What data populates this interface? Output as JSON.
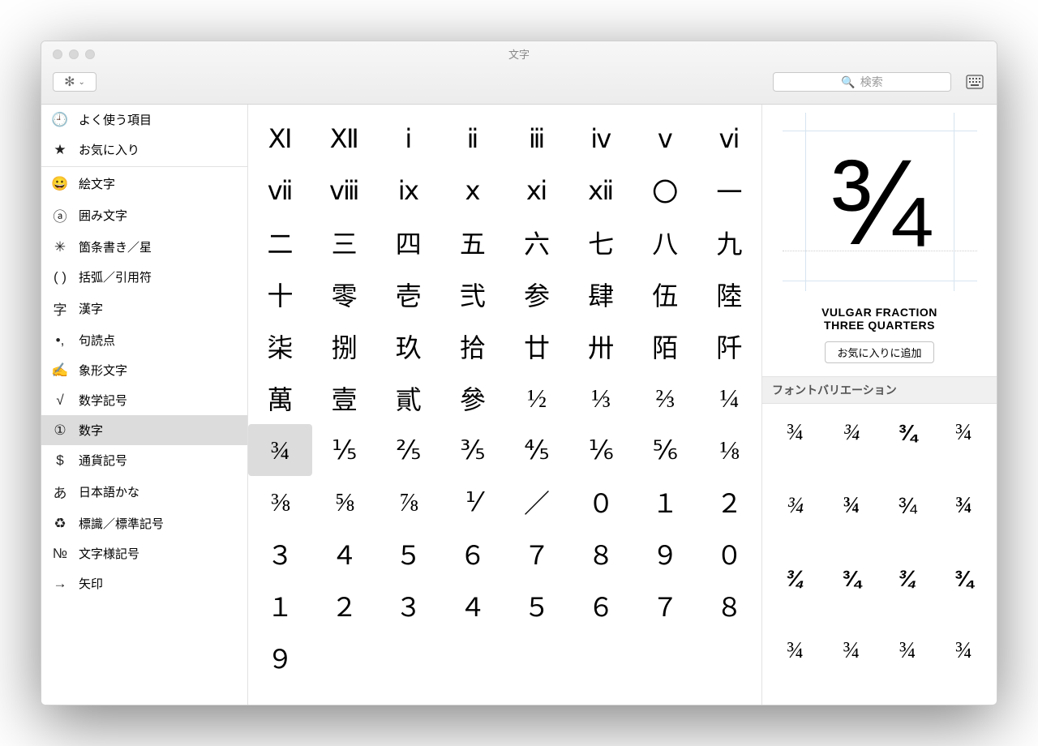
{
  "window": {
    "title": "文字"
  },
  "toolbar": {
    "search_placeholder": "検索"
  },
  "sidebar": {
    "frequent_label": "よく使う項目",
    "favorites_label": "お気に入り",
    "categories": [
      {
        "icon": "😀",
        "label": "絵文字"
      },
      {
        "icon": "ⓐ",
        "label": "囲み文字"
      },
      {
        "icon": "✳",
        "label": "箇条書き／星"
      },
      {
        "icon": "( )",
        "label": "括弧／引用符"
      },
      {
        "icon": "字",
        "label": "漢字"
      },
      {
        "icon": "•,",
        "label": "句読点"
      },
      {
        "icon": "✍",
        "label": "象形文字"
      },
      {
        "icon": "√",
        "label": "数学記号"
      },
      {
        "icon": "①",
        "label": "数字"
      },
      {
        "icon": "$",
        "label": "通貨記号"
      },
      {
        "icon": "あ",
        "label": "日本語かな"
      },
      {
        "icon": "♻",
        "label": "標識／標準記号"
      },
      {
        "icon": "№",
        "label": "文字様記号"
      },
      {
        "icon": "→",
        "label": "矢印"
      }
    ],
    "selected_index": 8
  },
  "grid": {
    "chars": [
      "Ⅺ",
      "Ⅻ",
      "ⅰ",
      "ⅱ",
      "ⅲ",
      "ⅳ",
      "ⅴ",
      "ⅵ",
      "ⅶ",
      "ⅷ",
      "ⅸ",
      "ⅹ",
      "ⅺ",
      "ⅻ",
      "〇",
      "一",
      "二",
      "三",
      "四",
      "五",
      "六",
      "七",
      "八",
      "九",
      "十",
      "零",
      "壱",
      "弐",
      "参",
      "肆",
      "伍",
      "陸",
      "柒",
      "捌",
      "玖",
      "拾",
      "廿",
      "卅",
      "陌",
      "阡",
      "萬",
      "壹",
      "貳",
      "參",
      "½",
      "⅓",
      "⅔",
      "¼",
      "¾",
      "⅕",
      "⅖",
      "⅗",
      "⅘",
      "⅙",
      "⅚",
      "⅛",
      "⅜",
      "⅝",
      "⅞",
      "⅟",
      "／",
      "０",
      "１",
      "２",
      "３",
      "４",
      "５",
      "６",
      "７",
      "８",
      "９",
      "０",
      "１",
      "２",
      "３",
      "４",
      "５",
      "６",
      "７",
      "８",
      "９"
    ],
    "selected_index": 48
  },
  "detail": {
    "glyph": "¾",
    "name": "VULGAR FRACTION\nTHREE QUARTERS",
    "add_favorite_label": "お気に入りに追加",
    "variation_header": "フォントバリエーション",
    "variations": [
      "¾",
      "¾",
      "¾",
      "¾",
      "¾",
      "¾",
      "¾",
      "¾",
      "¾",
      "¾",
      "¾",
      "¾",
      "¾",
      "¾",
      "¾",
      "¾"
    ]
  }
}
